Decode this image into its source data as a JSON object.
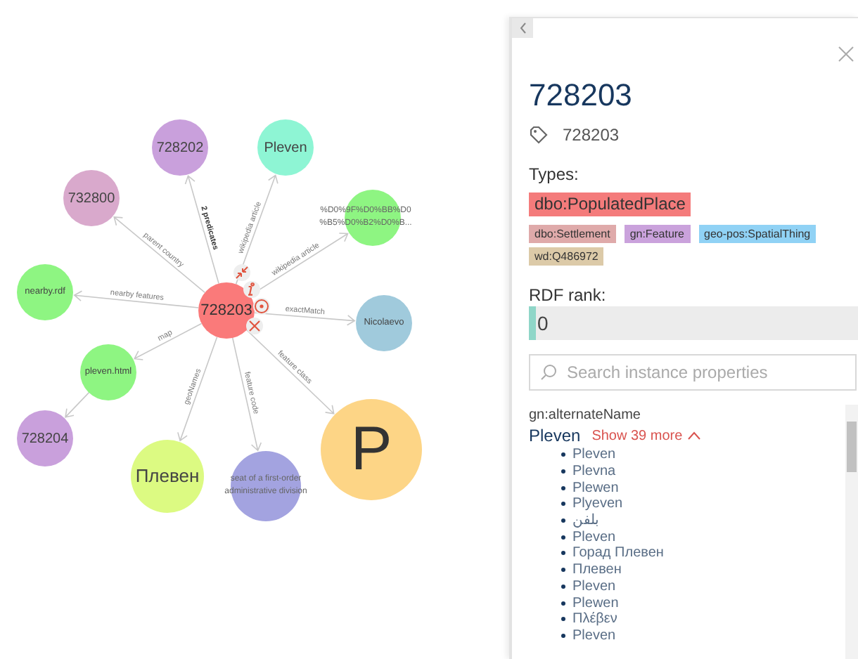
{
  "graph": {
    "nodes": [
      {
        "label": "728203",
        "color": "#fa7a7a",
        "kind": "center"
      },
      {
        "label": "728202",
        "color": "#c9a0dc",
        "kind": "node"
      },
      {
        "label": "Pleven",
        "color": "#8ef5d4",
        "kind": "node"
      },
      {
        "label": "732800",
        "color": "#d9a9cc",
        "kind": "node"
      },
      {
        "lines": [
          "%D0%9F%D0%BB%D0",
          "%B5%D0%B2%D0%B..."
        ],
        "color": "#8ef582",
        "kind": "outside"
      },
      {
        "label": "nearby.rdf",
        "color": "#8ef582",
        "kind": "small"
      },
      {
        "label": "Nicolaevo",
        "color": "#a0cadc",
        "kind": "small"
      },
      {
        "label": "pleven.html",
        "color": "#8ef582",
        "kind": "small"
      },
      {
        "label": "728204",
        "color": "#c9a0dc",
        "kind": "node"
      },
      {
        "label": "Плевен",
        "color": "#dcfa82",
        "kind": "node"
      },
      {
        "lines": [
          "seat of a first-order",
          "administrative division"
        ],
        "color": "#a3a3e0",
        "kind": "outside"
      },
      {
        "label": "P",
        "color": "#fdd586",
        "kind": "big"
      }
    ],
    "edges": [
      {
        "label": "2 predicates",
        "kind": "summary"
      },
      {
        "label": "wikipedia article",
        "kind": "plain"
      },
      {
        "label": "parent country",
        "kind": "plain"
      },
      {
        "label": "wikipedia article",
        "kind": "plain"
      },
      {
        "label": "nearby features",
        "kind": "plain"
      },
      {
        "label": "exactMatch",
        "kind": "plain"
      },
      {
        "label": "map",
        "kind": "plain"
      },
      {
        "kind": "plain"
      },
      {
        "label": "geoNames",
        "kind": "plain"
      },
      {
        "label": "feature code",
        "kind": "plain"
      },
      {
        "label": "feature class",
        "kind": "plain"
      }
    ],
    "node_actions": [
      {
        "kind": "collapse"
      },
      {
        "kind": "info"
      },
      {
        "kind": "focus"
      },
      {
        "kind": "remove"
      }
    ]
  },
  "panel": {
    "title": "728203",
    "label": "728203",
    "types_heading": "Types:",
    "types": [
      {
        "label": "dbo:PopulatedPlace",
        "color": "#f47b7b",
        "kind": "main"
      },
      {
        "label": "dbo:Settlement",
        "color": "#dfaaaa",
        "kind": "minor"
      },
      {
        "label": "gn:Feature",
        "color": "#caa2dc",
        "kind": "minor"
      },
      {
        "label": "geo-pos:SpatialThing",
        "color": "#90d2f5",
        "kind": "minor"
      },
      {
        "label": "wd:Q486972",
        "color": "#dccaa8",
        "kind": "minor"
      }
    ],
    "rank_heading": "RDF rank:",
    "rank": {
      "value": "0",
      "level": 0.02
    },
    "search": {
      "placeholder": "Search instance properties"
    },
    "properties": [
      {
        "name": "gn:alternateName",
        "value": "Pleven",
        "more": "Show 39 more",
        "expanded": true,
        "values": [
          "Pleven",
          "Plevna",
          "Plewen",
          "Plyeven",
          "بلفن",
          "Pleven",
          "Горад Плевен",
          "Плевен",
          "Pleven",
          "Plewen",
          "Πλέβεν",
          "Pleven"
        ]
      }
    ]
  }
}
